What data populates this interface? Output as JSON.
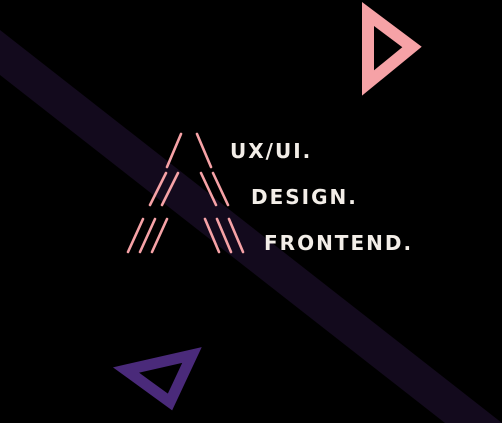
{
  "lines": [
    "UX/UI.",
    "DESIGN.",
    "FRONTEND."
  ],
  "colors": {
    "background": "#000000",
    "band": "#130a1d",
    "accent_pink": "#f6a2a6",
    "accent_purple": "#4a2a7a",
    "text": "#f3eee8"
  },
  "icons": {
    "logo": "stripe-a-logo",
    "top_shape": "triangle-outline-pink",
    "bottom_shape": "triangle-outline-purple"
  }
}
